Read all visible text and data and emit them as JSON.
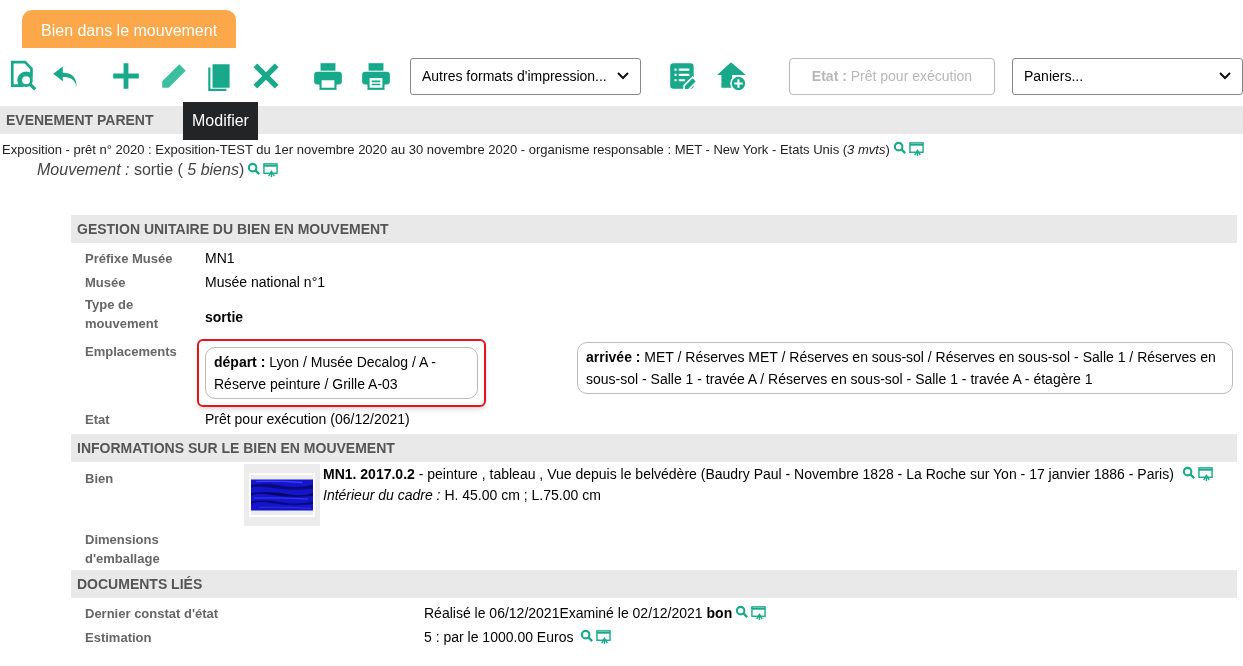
{
  "tab": {
    "label": "Bien dans le mouvement",
    "selected": true
  },
  "toolbar": {
    "icons": [
      {
        "kind": "preview"
      },
      {
        "kind": "undo"
      },
      {
        "kind": "add"
      },
      {
        "kind": "edit",
        "tooltip": "Modifier"
      },
      {
        "kind": "copy"
      },
      {
        "kind": "delete"
      },
      {
        "kind": "print"
      },
      {
        "kind": "print-alt"
      },
      {
        "kind": "list-edit"
      },
      {
        "kind": "home-add"
      }
    ],
    "print_select": "Autres formats d'impression...",
    "state_button": {
      "label": "Etat :",
      "value": "Prêt pour exécution",
      "disabled": true
    },
    "basket_select": "Paniers..."
  },
  "parent_event": {
    "heading": "EVENEMENT PARENT",
    "description": "Exposition - prêt n° 2020 : Exposition-TEST du 1er novembre 2020 au 30 novembre 2020 - organisme responsable : MET - New York - Etats Unis (*3 mvts*)",
    "movement": "*Mouvement :* sortie ( *5 biens*)"
  },
  "gestion": {
    "heading": "GESTION UNITAIRE DU BIEN EN MOUVEMENT",
    "fields": [
      {
        "kind": "text",
        "label": "Préfixe Musée",
        "value": "MN1"
      },
      {
        "kind": "text",
        "label": "Musée",
        "value": "Musée national n°1"
      },
      {
        "kind": "bold",
        "label": "Type de mouvement",
        "value": "sortie"
      },
      {
        "kind": "locations",
        "label": "Emplacements",
        "departure": {
          "label": "départ :",
          "value": "Lyon / Musée Decalog / A - Réserve peinture / Grille A-03",
          "highlighted": true
        },
        "arrival": {
          "label": "arrivée :",
          "value": "MET / Réserves MET / Réserves en sous-sol / Réserves en sous-sol - Salle 1 / Réserves en sous-sol - Salle 1 - travée A / Réserves en sous-sol - Salle 1 - travée A - étagère 1",
          "highlighted": false
        }
      },
      {
        "kind": "text",
        "label": "Etat",
        "value": "Prêt pour exécution (06/12/2021)"
      }
    ]
  },
  "info": {
    "heading": "INFORMATIONS SUR LE BIEN EN MOUVEMENT",
    "item": {
      "label": "Bien",
      "title": "**MN1. 2017.0.2** - peinture , tableau , Vue depuis le belvédère (Baudry Paul - Novembre 1828 - La Roche sur Yon - 17 janvier 1886 - Paris)",
      "dimensions": "*Intérieur du cadre :* H. 45.00 cm ; L.75.00 cm"
    },
    "packing_label": "Dimensions d'emballage"
  },
  "documents": {
    "heading": "DOCUMENTS LIÉS",
    "rows": [
      {
        "label": "Dernier constat d'état",
        "value": "Réalisé le 06/12/2021Examiné le 02/12/2021 **bon**"
      },
      {
        "label": "Estimation",
        "value": "5 : par le 1000.00 Euros "
      }
    ]
  }
}
